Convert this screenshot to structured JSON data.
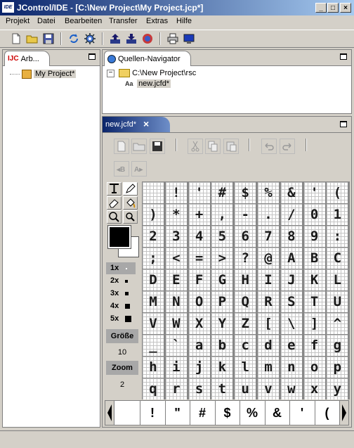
{
  "window": {
    "icon_label": "IDE",
    "title": "JControl/IDE - [C:\\New Project\\My Project.jcp*]",
    "minimize": "_",
    "maximize": "□",
    "close": "×"
  },
  "menu": [
    "Projekt",
    "Datei",
    "Bearbeiten",
    "Transfer",
    "Extras",
    "Hilfe"
  ],
  "toolbar_icons": [
    "new-file-icon",
    "open-folder-icon",
    "save-icon",
    "refresh-icon",
    "gear-icon",
    "upload-icon",
    "download-icon",
    "simulate-icon",
    "print-icon",
    "monitor-icon"
  ],
  "left_panel": {
    "tab_label": "Arb...",
    "tree_root": "My Project*"
  },
  "navigator": {
    "tab_label": "Quellen-Navigator",
    "folder": "C:\\New Project\\rsc",
    "file": "new.jcfd*",
    "expander": "−"
  },
  "editor": {
    "tab_label": "new.jcfd*",
    "close": "×",
    "sizes": [
      "1x",
      "2x",
      "3x",
      "4x",
      "5x"
    ],
    "selected_size": "1x",
    "groesse_label": "Größe",
    "groesse_value": "10",
    "zoom_label": "Zoom",
    "zoom_value": "2",
    "glyph_cells": [
      "",
      "!",
      "'",
      "#",
      "$",
      "%",
      "&",
      "'",
      "(",
      ")",
      "*",
      "+",
      ",",
      "-",
      ".",
      "/",
      "0",
      "1",
      "2",
      "3",
      "4",
      "5",
      "6",
      "7",
      "8",
      "9",
      ":",
      ";",
      "<",
      "=",
      ">",
      "?",
      "@",
      "A",
      "B",
      "C",
      "D",
      "E",
      "F",
      "G",
      "H",
      "I",
      "J",
      "K",
      "L",
      "M",
      "N",
      "O",
      "P",
      "Q",
      "R",
      "S",
      "T",
      "U",
      "V",
      "W",
      "X",
      "Y",
      "Z",
      "[",
      "\\",
      "]",
      "^",
      "_",
      "`",
      "a",
      "b",
      "c",
      "d",
      "e",
      "f",
      "g",
      "h",
      "i",
      "j",
      "k",
      "l",
      "m",
      "n",
      "o",
      "p",
      "q",
      "r",
      "s",
      "t",
      "u",
      "v",
      "w",
      "x",
      "y"
    ],
    "bottom_chars": [
      "",
      "!",
      "\"",
      "#",
      "$",
      "%",
      "&",
      "'",
      "("
    ]
  },
  "colors": {
    "titlebar_start": "#0a246a",
    "titlebar_end": "#a6caf0",
    "chrome": "#d4d0c8",
    "foreground_color": "#000000",
    "background_color": "#ffffff"
  }
}
